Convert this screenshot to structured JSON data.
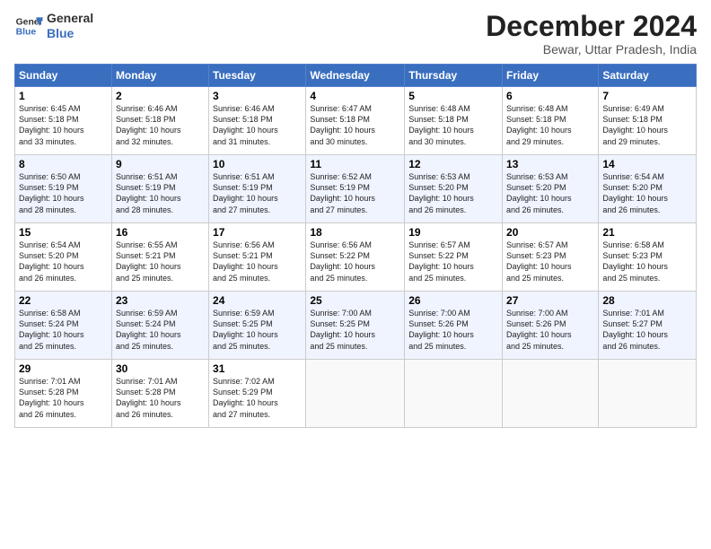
{
  "header": {
    "logo_line1": "General",
    "logo_line2": "Blue",
    "title": "December 2024",
    "subtitle": "Bewar, Uttar Pradesh, India"
  },
  "weekdays": [
    "Sunday",
    "Monday",
    "Tuesday",
    "Wednesday",
    "Thursday",
    "Friday",
    "Saturday"
  ],
  "weeks": [
    [
      {
        "day": "1",
        "info": "Sunrise: 6:45 AM\nSunset: 5:18 PM\nDaylight: 10 hours\nand 33 minutes."
      },
      {
        "day": "2",
        "info": "Sunrise: 6:46 AM\nSunset: 5:18 PM\nDaylight: 10 hours\nand 32 minutes."
      },
      {
        "day": "3",
        "info": "Sunrise: 6:46 AM\nSunset: 5:18 PM\nDaylight: 10 hours\nand 31 minutes."
      },
      {
        "day": "4",
        "info": "Sunrise: 6:47 AM\nSunset: 5:18 PM\nDaylight: 10 hours\nand 30 minutes."
      },
      {
        "day": "5",
        "info": "Sunrise: 6:48 AM\nSunset: 5:18 PM\nDaylight: 10 hours\nand 30 minutes."
      },
      {
        "day": "6",
        "info": "Sunrise: 6:48 AM\nSunset: 5:18 PM\nDaylight: 10 hours\nand 29 minutes."
      },
      {
        "day": "7",
        "info": "Sunrise: 6:49 AM\nSunset: 5:18 PM\nDaylight: 10 hours\nand 29 minutes."
      }
    ],
    [
      {
        "day": "8",
        "info": "Sunrise: 6:50 AM\nSunset: 5:19 PM\nDaylight: 10 hours\nand 28 minutes."
      },
      {
        "day": "9",
        "info": "Sunrise: 6:51 AM\nSunset: 5:19 PM\nDaylight: 10 hours\nand 28 minutes."
      },
      {
        "day": "10",
        "info": "Sunrise: 6:51 AM\nSunset: 5:19 PM\nDaylight: 10 hours\nand 27 minutes."
      },
      {
        "day": "11",
        "info": "Sunrise: 6:52 AM\nSunset: 5:19 PM\nDaylight: 10 hours\nand 27 minutes."
      },
      {
        "day": "12",
        "info": "Sunrise: 6:53 AM\nSunset: 5:20 PM\nDaylight: 10 hours\nand 26 minutes."
      },
      {
        "day": "13",
        "info": "Sunrise: 6:53 AM\nSunset: 5:20 PM\nDaylight: 10 hours\nand 26 minutes."
      },
      {
        "day": "14",
        "info": "Sunrise: 6:54 AM\nSunset: 5:20 PM\nDaylight: 10 hours\nand 26 minutes."
      }
    ],
    [
      {
        "day": "15",
        "info": "Sunrise: 6:54 AM\nSunset: 5:20 PM\nDaylight: 10 hours\nand 26 minutes."
      },
      {
        "day": "16",
        "info": "Sunrise: 6:55 AM\nSunset: 5:21 PM\nDaylight: 10 hours\nand 25 minutes."
      },
      {
        "day": "17",
        "info": "Sunrise: 6:56 AM\nSunset: 5:21 PM\nDaylight: 10 hours\nand 25 minutes."
      },
      {
        "day": "18",
        "info": "Sunrise: 6:56 AM\nSunset: 5:22 PM\nDaylight: 10 hours\nand 25 minutes."
      },
      {
        "day": "19",
        "info": "Sunrise: 6:57 AM\nSunset: 5:22 PM\nDaylight: 10 hours\nand 25 minutes."
      },
      {
        "day": "20",
        "info": "Sunrise: 6:57 AM\nSunset: 5:23 PM\nDaylight: 10 hours\nand 25 minutes."
      },
      {
        "day": "21",
        "info": "Sunrise: 6:58 AM\nSunset: 5:23 PM\nDaylight: 10 hours\nand 25 minutes."
      }
    ],
    [
      {
        "day": "22",
        "info": "Sunrise: 6:58 AM\nSunset: 5:24 PM\nDaylight: 10 hours\nand 25 minutes."
      },
      {
        "day": "23",
        "info": "Sunrise: 6:59 AM\nSunset: 5:24 PM\nDaylight: 10 hours\nand 25 minutes."
      },
      {
        "day": "24",
        "info": "Sunrise: 6:59 AM\nSunset: 5:25 PM\nDaylight: 10 hours\nand 25 minutes."
      },
      {
        "day": "25",
        "info": "Sunrise: 7:00 AM\nSunset: 5:25 PM\nDaylight: 10 hours\nand 25 minutes."
      },
      {
        "day": "26",
        "info": "Sunrise: 7:00 AM\nSunset: 5:26 PM\nDaylight: 10 hours\nand 25 minutes."
      },
      {
        "day": "27",
        "info": "Sunrise: 7:00 AM\nSunset: 5:26 PM\nDaylight: 10 hours\nand 25 minutes."
      },
      {
        "day": "28",
        "info": "Sunrise: 7:01 AM\nSunset: 5:27 PM\nDaylight: 10 hours\nand 26 minutes."
      }
    ],
    [
      {
        "day": "29",
        "info": "Sunrise: 7:01 AM\nSunset: 5:28 PM\nDaylight: 10 hours\nand 26 minutes."
      },
      {
        "day": "30",
        "info": "Sunrise: 7:01 AM\nSunset: 5:28 PM\nDaylight: 10 hours\nand 26 minutes."
      },
      {
        "day": "31",
        "info": "Sunrise: 7:02 AM\nSunset: 5:29 PM\nDaylight: 10 hours\nand 27 minutes."
      },
      {
        "day": "",
        "info": ""
      },
      {
        "day": "",
        "info": ""
      },
      {
        "day": "",
        "info": ""
      },
      {
        "day": "",
        "info": ""
      }
    ]
  ]
}
